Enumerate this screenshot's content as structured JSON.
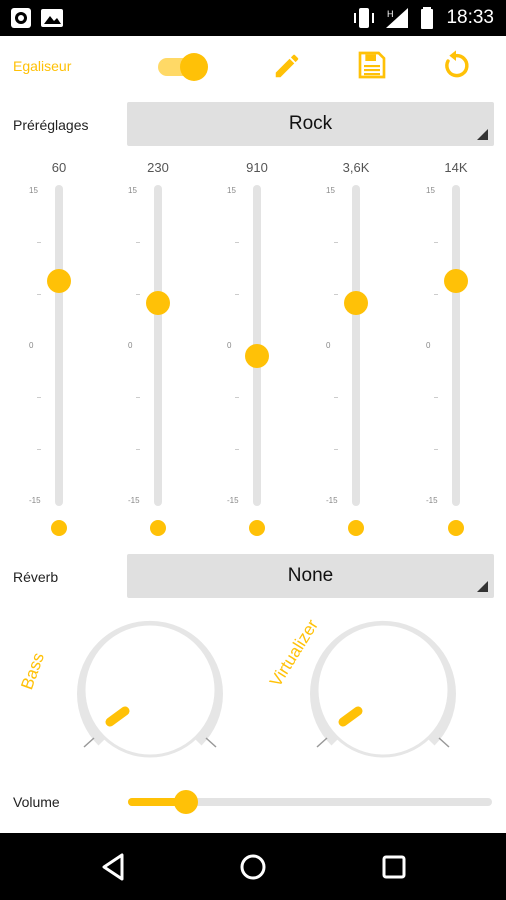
{
  "status": {
    "time": "18:33"
  },
  "toolbar": {
    "equalizer_label": "Egaliseur",
    "toggle_on": true
  },
  "presets": {
    "label": "Préréglages",
    "value": "Rock"
  },
  "eq": {
    "bands": [
      {
        "freq": "60",
        "level_db": 6
      },
      {
        "freq": "230",
        "level_db": 4
      },
      {
        "freq": "910",
        "level_db": -1
      },
      {
        "freq": "3,6K",
        "level_db": 4
      },
      {
        "freq": "14K",
        "level_db": 6
      }
    ],
    "ticks": {
      "max": "15",
      "zero": "0",
      "min": "-15"
    }
  },
  "reverb": {
    "label": "Réverb",
    "value": "None"
  },
  "knobs": {
    "bass_label": "Bass",
    "virtualizer_label": "Virtualizer"
  },
  "volume": {
    "label": "Volume",
    "level": 0.16
  },
  "colors": {
    "accent": "#FFC107",
    "track": "#e3e3e3",
    "dropdown": "#e0e0e0"
  }
}
